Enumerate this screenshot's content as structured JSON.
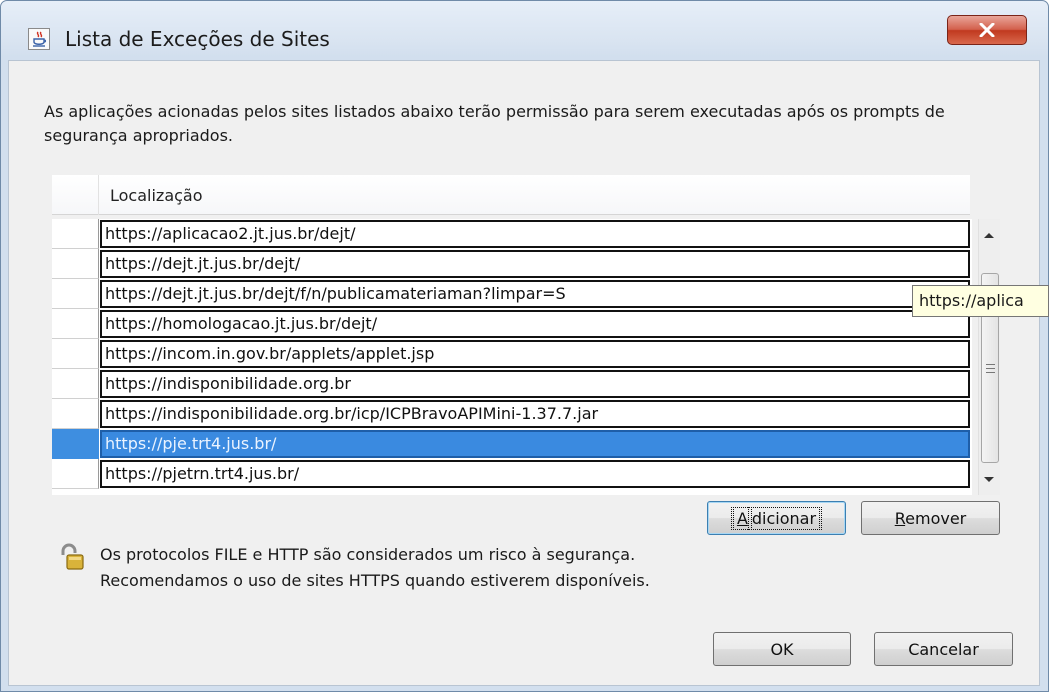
{
  "window": {
    "title": "Lista de Exceções de Sites",
    "close_label": "X"
  },
  "description": "As aplicações acionadas pelos sites listados abaixo terão permissão para serem executadas após os prompts de segurança apropriados.",
  "table": {
    "column_header": "Localização",
    "rows": [
      "https://aplicacao2.jt.jus.br/dejt/",
      "https://dejt.jt.jus.br/dejt/",
      "https://dejt.jt.jus.br/dejt/f/n/publicamateriaman?limpar=S",
      "https://homologacao.jt.jus.br/dejt/",
      "https://incom.in.gov.br/applets/applet.jsp",
      "https://indisponibilidade.org.br",
      "https://indisponibilidade.org.br/icp/ICPBravoAPIMini-1.37.7.jar",
      "https://pje.trt4.jus.br/",
      "https://pjetrn.trt4.jus.br/"
    ],
    "selected_row": "https://pje.trt4.jus.br/",
    "tooltip": "https://aplica"
  },
  "buttons": {
    "add": {
      "label_underlined": "A",
      "label_rest": "dicionar"
    },
    "remove": {
      "label_underlined": "R",
      "label_rest": "emover"
    },
    "ok": "OK",
    "cancel": "Cancelar"
  },
  "security_note": {
    "line1": "Os protocolos FILE e HTTP são considerados um risco à segurança.",
    "line2": "Recomendamos o uso de sites HTTPS quando estiverem disponíveis."
  },
  "icons": {
    "app": "java-coffee-icon",
    "close": "close-icon",
    "lock": "padlock-icon"
  },
  "colors": {
    "selection": "#3a8ae0",
    "tooltip_bg": "#ffffe1",
    "close_button": "#c0391f"
  }
}
